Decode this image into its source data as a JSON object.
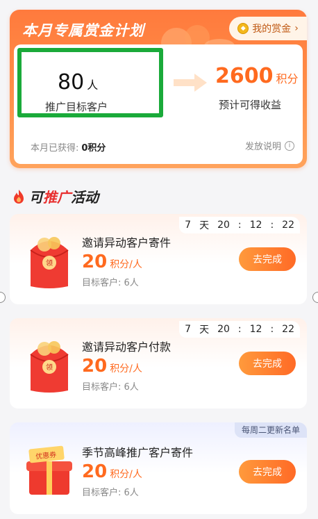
{
  "plan": {
    "title": "本月专属赏金计划",
    "my_reward_label": "我的赏金",
    "target_count": "80",
    "target_unit": "人",
    "target_label": "推广目标客户",
    "expected_points": "2600",
    "expected_unit": "积分",
    "expected_label": "预计可得收益",
    "earned_label": "本月已获得:",
    "earned_value": "0积分",
    "rules_label": "发放说明"
  },
  "section": {
    "title_prefix": "可",
    "title_highlight": "推广",
    "title_suffix": "活动"
  },
  "activities": [
    {
      "title": "邀请异动客户寄件",
      "points": "20",
      "unit": "积分/人",
      "target": "目标客户: 6人",
      "button": "去完成",
      "timer": {
        "d": "7",
        "d_unit": "天",
        "h": "20",
        "sep1": ":",
        "m": "12",
        "sep2": ":",
        "s": "22"
      },
      "image": "red-envelope-icon"
    },
    {
      "title": "邀请异动客户付款",
      "points": "20",
      "unit": "积分/人",
      "target": "目标客户: 6人",
      "button": "去完成",
      "timer": {
        "d": "7",
        "d_unit": "天",
        "h": "20",
        "sep1": ":",
        "m": "12",
        "sep2": ":",
        "s": "22"
      },
      "image": "red-envelope-icon"
    },
    {
      "title": "季节高峰推广客户寄件",
      "points": "20",
      "unit": "积分/人",
      "target": "目标客户: 6人",
      "button": "去完成",
      "tag": "每周二更新名单",
      "coupon_label": "优惠券",
      "image": "gift-box-icon"
    }
  ],
  "colors": {
    "accent": "#ff6a1f",
    "highlight_box": "#1aaa3a",
    "header_gradient_start": "#ff7a3d"
  }
}
